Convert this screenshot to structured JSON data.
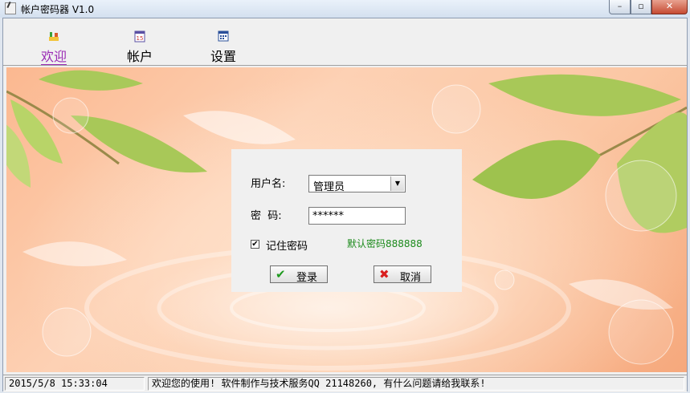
{
  "window": {
    "title": "帐户密码器 V1.0",
    "controls": {
      "minimize": "–",
      "maximize": "▫",
      "close": "✕"
    }
  },
  "toolbar": {
    "items": [
      {
        "label": "欢迎",
        "icon": "welcome-icon",
        "active": true
      },
      {
        "label": "帐户",
        "icon": "calendar-icon"
      },
      {
        "label": "设置",
        "icon": "grid-calendar-icon"
      }
    ]
  },
  "login": {
    "username_label": "用户名:",
    "username_value": "管理员",
    "password_label": "密  码:",
    "password_value": "******",
    "remember_label": "记住密码",
    "remember_checked": true,
    "remember_mark": "✔",
    "hint": "默认密码888888",
    "login_button": "登录",
    "cancel_button": "取消",
    "login_icon": "✔",
    "cancel_icon": "✖"
  },
  "status": {
    "datetime": "2015/5/8 15:33:04",
    "message": "欢迎您的使用! 软件制作与技术服务QQ 21148260, 有什么问题请给我联系!"
  },
  "colors": {
    "accent_active_tab": "#9a2ab5",
    "hint_green": "#1b8a1b",
    "close_red": "#c64b33"
  }
}
